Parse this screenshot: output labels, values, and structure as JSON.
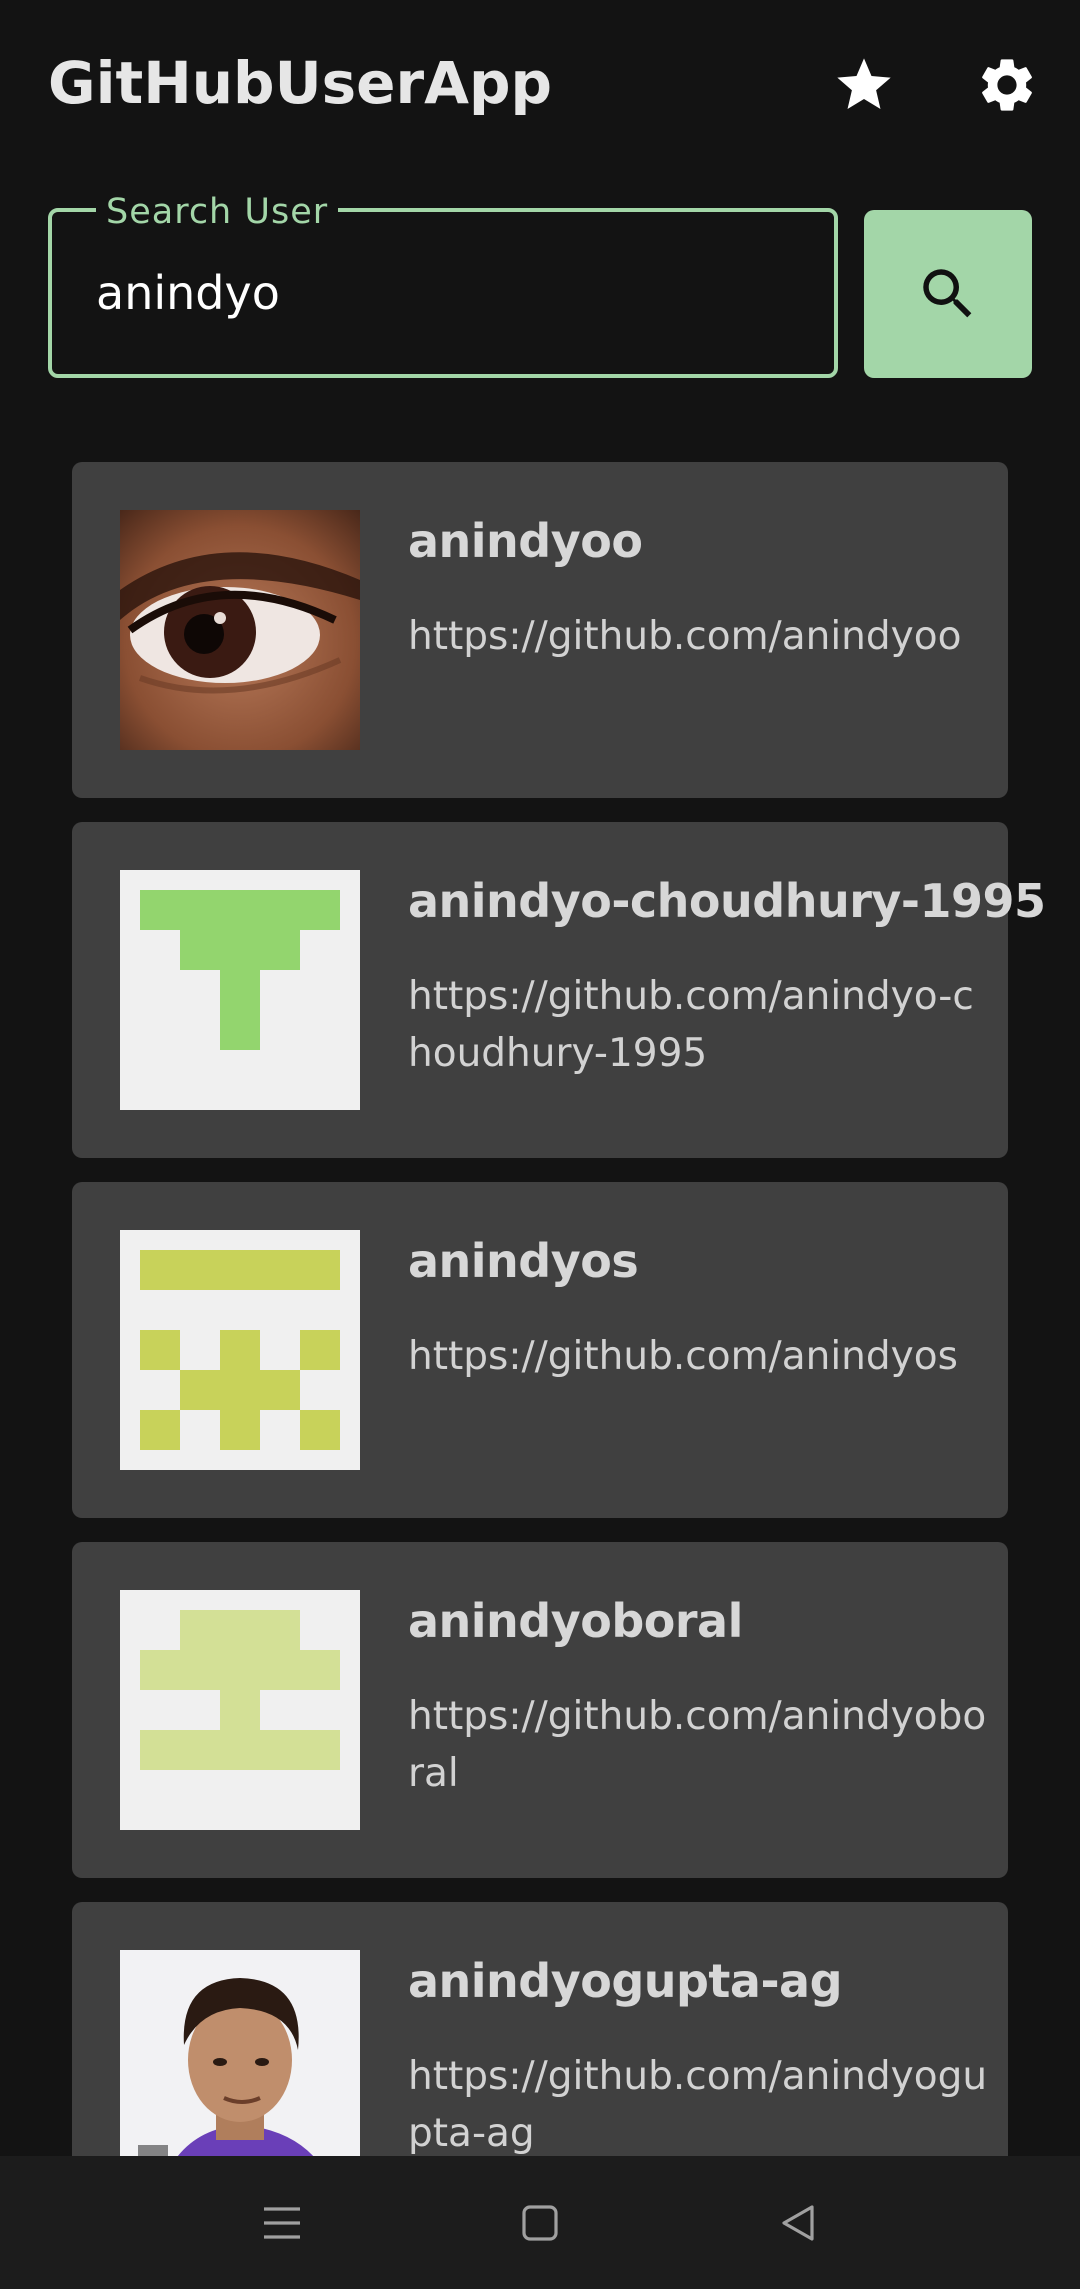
{
  "app_bar": {
    "title": "GitHubUserApp",
    "favorites_icon": "star-icon",
    "settings_icon": "gear-icon"
  },
  "search": {
    "label": "Search User",
    "value": "anindyo",
    "button_icon": "search-icon"
  },
  "results": [
    {
      "username": "anindyoo",
      "url": "https://github.com/anindyoo",
      "avatar": "photo-eye"
    },
    {
      "username": "anindyo-choudhury-1995",
      "url": "https://github.com/anindyo-choudhury-1995",
      "avatar": "identicon-green"
    },
    {
      "username": "anindyos",
      "url": "https://github.com/anindyos",
      "avatar": "identicon-yellow-green"
    },
    {
      "username": "anindyoboral",
      "url": "https://github.com/anindyoboral",
      "avatar": "identicon-pale-green"
    },
    {
      "username": "anindyogupta-ag",
      "url": "https://github.com/anindyogupta-ag",
      "avatar": "photo-person"
    }
  ],
  "nav_bar": {
    "menu_icon": "menu-icon",
    "home_icon": "home-square-icon",
    "back_icon": "back-triangle-icon"
  },
  "colors": {
    "background": "#131313",
    "accent": "#a3d6a8",
    "card": "#404040",
    "nav_bar": "#1c1c1c"
  }
}
